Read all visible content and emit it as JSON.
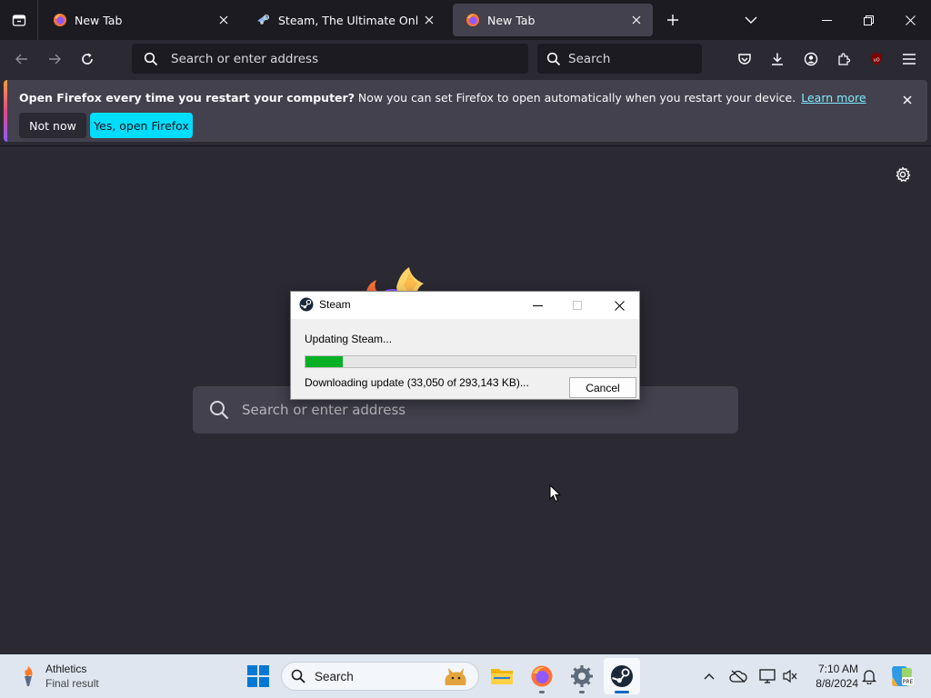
{
  "browser": {
    "tabs": [
      {
        "title": "New Tab",
        "active": false
      },
      {
        "title": "Steam, The Ultimate Online Game Platform",
        "active": false
      },
      {
        "title": "New Tab",
        "active": true
      }
    ],
    "url_placeholder": "Search or enter address",
    "search_placeholder": "Search"
  },
  "notification": {
    "heading": "Open Firefox every time you restart your computer?",
    "message": " Now you can set Firefox to open automatically when you restart your device.",
    "link": "Learn more",
    "not_now": "Not now",
    "yes": "Yes, open Firefox"
  },
  "newtab": {
    "search_placeholder": "Search or enter address"
  },
  "steam_dialog": {
    "title": "Steam",
    "status": "Updating Steam...",
    "progress": 0.113,
    "detail": "Downloading update (33,050 of 293,143 KB)...",
    "cancel": "Cancel"
  },
  "taskbar": {
    "widget_title": "Athletics",
    "widget_subtitle": "Final result",
    "search_placeholder": "Search",
    "time": "7:10 AM",
    "date": "8/8/2024",
    "pinned_apps": [
      "file-explorer-icon",
      "firefox-icon",
      "settings-icon",
      "steam-icon"
    ]
  },
  "colors": {
    "chrome_dark": "#1c1b22",
    "content_bg": "#2b2a33",
    "accent_cyan": "#00ddff",
    "progress_green": "#06b025",
    "taskbar_bg": "#dfe6ef"
  }
}
